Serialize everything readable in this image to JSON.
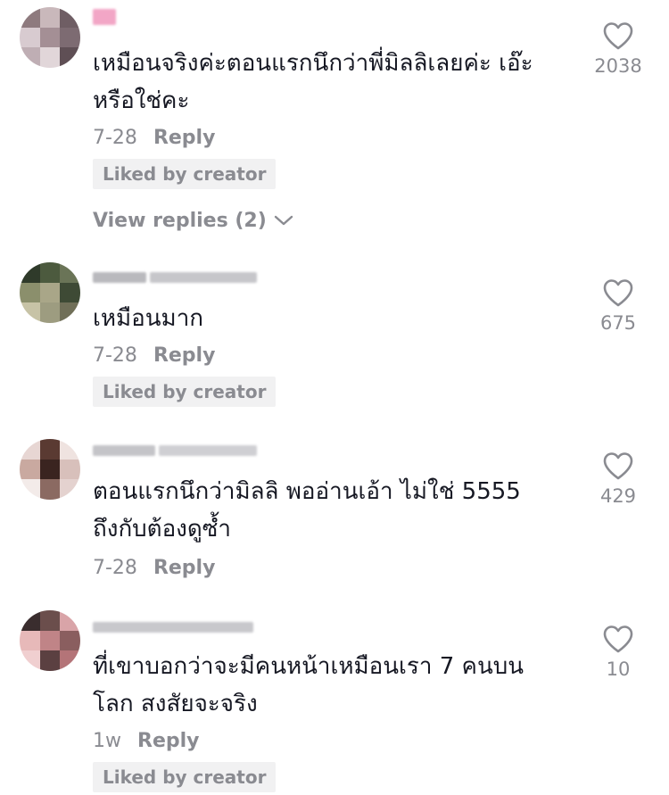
{
  "comments": [
    {
      "text": "เหมือนจริงค่ะตอนแรกนึกว่าพี่มิลลิเลยค่ะ เอ๊ะ\nหรือใช่คะ",
      "date": "7-28",
      "reply_label": "Reply",
      "liked_by_creator": "Liked by creator",
      "view_replies": "View replies (2)",
      "likes": "2038",
      "avatar_colors": [
        "#8e7a7e",
        "#c9b8bb",
        "#6f5e64",
        "#d8cbd0",
        "#a48f95",
        "#7d6b72",
        "#bfaeb4",
        "#e1d6d9",
        "#5f4f55"
      ],
      "username_tint": "#f06aa8"
    },
    {
      "text": "เหมือนมาก",
      "date": "7-28",
      "reply_label": "Reply",
      "liked_by_creator": "Liked by creator",
      "likes": "675",
      "avatar_colors": [
        "#2f3a2a",
        "#4c5a3e",
        "#6a7457",
        "#8b8f6c",
        "#a9a688",
        "#3e4a35",
        "#c7c3a6",
        "#9d9c80",
        "#706f58"
      ],
      "username_tint": "#9a9a9f"
    },
    {
      "text": "ตอนแรกนึกว่ามิลลิ พออ่านเอ้า ไม่ใช่ 5555\nถึงกับต้องดูซ้ำ",
      "date": "7-28",
      "reply_label": "Reply",
      "likes": "429",
      "avatar_colors": [
        "#e7d6d3",
        "#5a3a32",
        "#efe3e0",
        "#c9a9a0",
        "#3a2420",
        "#d8c0bb",
        "#f3ebe9",
        "#8b6a62",
        "#e4d2cf"
      ],
      "username_tint": "#9a9a9f"
    },
    {
      "text": "ที่เขาบอกว่าจะมีคนหน้าเหมือนเรา 7 คนบน\nโลก สงสัยจะจริง",
      "date": "1w",
      "reply_label": "Reply",
      "liked_by_creator": "Liked by creator",
      "likes": "10",
      "avatar_colors": [
        "#3a2d2e",
        "#6b4e4c",
        "#d9a4a8",
        "#e7b9b9",
        "#c08487",
        "#8a5e5f",
        "#f0cfd0",
        "#5b4041",
        "#b47478"
      ],
      "username_tint": "#9a9a9f"
    }
  ]
}
